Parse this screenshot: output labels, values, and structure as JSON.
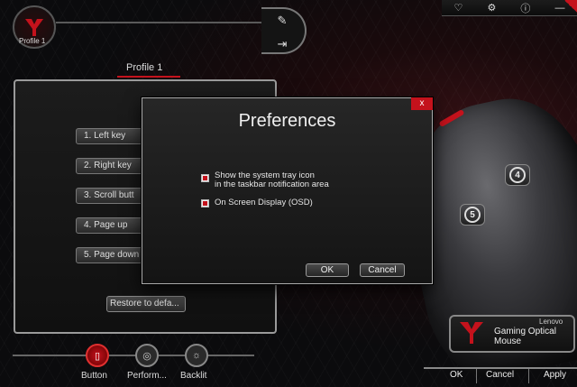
{
  "header": {
    "profile_label": "Profile 1"
  },
  "window_icons": [
    "heart-icon",
    "settings-icon",
    "info-icon",
    "minimize-icon"
  ],
  "left_panel": {
    "title": "Profile 1",
    "buttons": [
      {
        "label": "1.  Left key"
      },
      {
        "label": "2.  Right key"
      },
      {
        "label": "3.  Scroll butt"
      },
      {
        "label": "4.  Page up"
      },
      {
        "label": "5.  Page down"
      }
    ],
    "restore_label": "Restore to defa..."
  },
  "nav": {
    "items": [
      {
        "label": "Button",
        "active": true
      },
      {
        "label": "Perform...",
        "active": false
      },
      {
        "label": "Backlit",
        "active": false
      }
    ]
  },
  "mouse_buttons": [
    "4",
    "5"
  ],
  "brand": {
    "company": "Lenovo",
    "product": "Gaming Optical Mouse"
  },
  "footer": {
    "ok": "OK",
    "cancel": "Cancel",
    "apply": "Apply"
  },
  "dialog": {
    "title": "Preferences",
    "close": "x",
    "options": [
      {
        "line1": "Show the system tray icon",
        "line2": "in the taskbar notification area",
        "checked": true
      },
      {
        "line1": "On Screen Display (OSD)",
        "line2": "",
        "checked": true
      }
    ],
    "ok": "OK",
    "cancel": "Cancel"
  },
  "colors": {
    "accent": "#c4121c",
    "panel_border": "#9a9a9a",
    "text": "#e6e6e6"
  }
}
